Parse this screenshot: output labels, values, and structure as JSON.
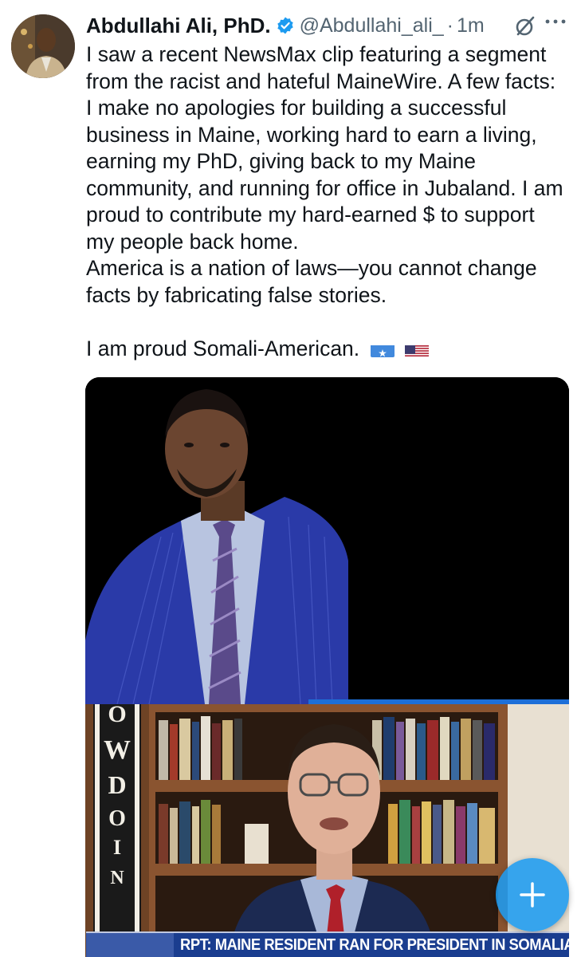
{
  "author": {
    "name": "Abdullahi Ali, PhD.",
    "handle": "@Abdullahi_ali_",
    "separator": "·",
    "time": "1m"
  },
  "tweet": {
    "lines": [
      "I saw a recent NewsMax clip featuring a segment",
      "from the racist and hateful MaineWire. A few facts:",
      "I make no apologies for building a successful",
      "business in Maine, working hard to earn a living,",
      "earning my PhD, giving back to my Maine",
      "community, and running for office in Jubaland. I am",
      "proud to contribute my hard-earned $ to support",
      "my people back home.",
      "America is a nation of laws—you cannot change",
      "facts by fabricating false stories."
    ],
    "closing": "I am proud Somali-American.",
    "flags": [
      "somalia-flag-icon",
      "us-flag-icon"
    ]
  },
  "media": {
    "pennant_letters": [
      "O",
      "W",
      "D",
      "O",
      "I",
      "N"
    ],
    "chyron": "RPT: MAINE RESIDENT RAN FOR PRESIDENT IN SOMALIA"
  },
  "icons": {
    "verified": "verified-badge-icon",
    "grok": "grok-icon",
    "more": "more-options-icon",
    "compose": "compose-plus-icon"
  },
  "colors": {
    "accent": "#1d9bf0",
    "text": "#0f1419",
    "secondary": "#536471",
    "chyron_bg": "#1a3d8f"
  }
}
